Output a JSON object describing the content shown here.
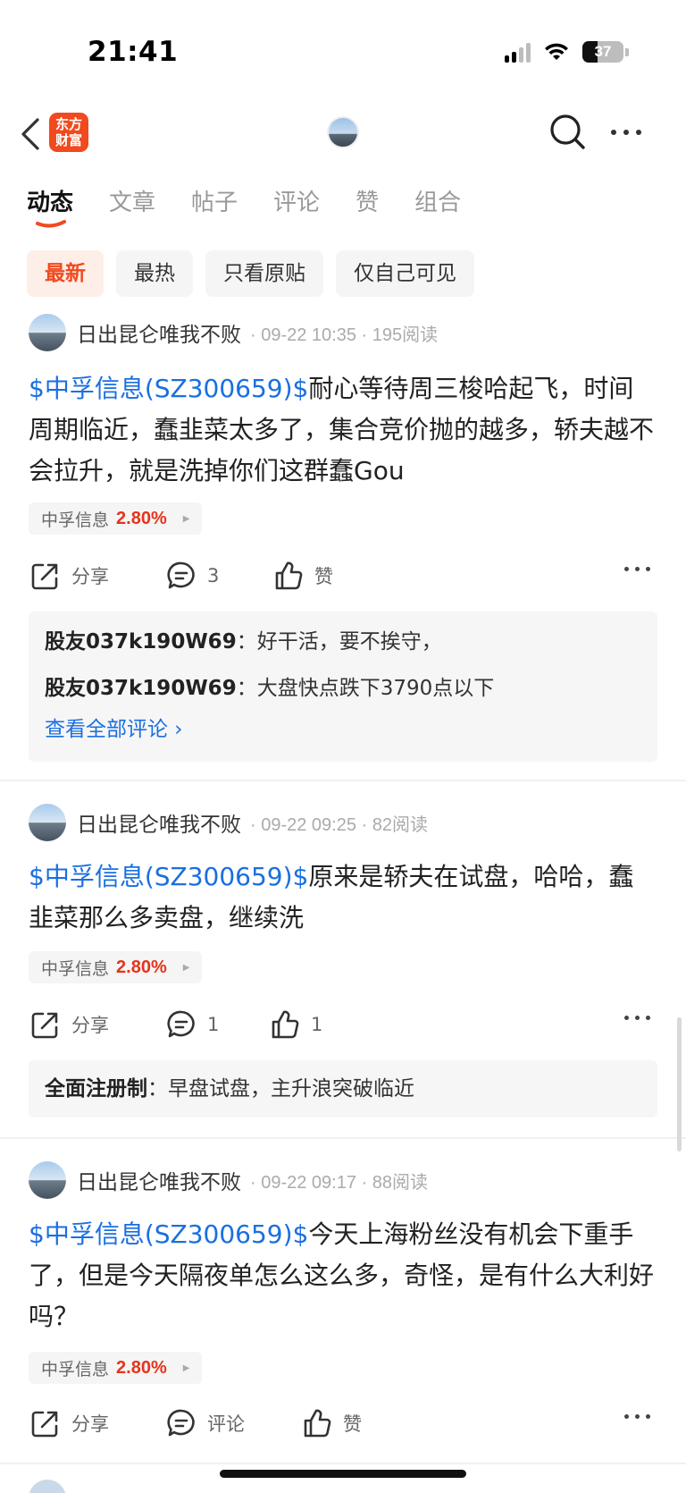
{
  "status": {
    "time": "21:41",
    "battery": "37",
    "battery_level": 0.37
  },
  "nav": {
    "logo_text_top": "东方",
    "logo_text_bottom": "财富"
  },
  "tabs": [
    {
      "label": "动态",
      "active": true
    },
    {
      "label": "文章",
      "active": false
    },
    {
      "label": "帖子",
      "active": false
    },
    {
      "label": "评论",
      "active": false
    },
    {
      "label": "赞",
      "active": false
    },
    {
      "label": "组合",
      "active": false
    }
  ],
  "filters": [
    {
      "label": "最新",
      "active": true
    },
    {
      "label": "最热",
      "active": false
    },
    {
      "label": "只看原贴",
      "active": false
    },
    {
      "label": "仅自己可见",
      "active": false
    }
  ],
  "posts": [
    {
      "author": "日出昆仑唯我不败",
      "meta": "· 09-22 10:35 · 195阅读",
      "stock_link": "$中孚信息(SZ300659)$",
      "text": "耐心等待周三梭哈起飞，时间周期临近，蠢韭菜太多了，集合竞价抛的越多，轿夫越不会拉升，就是洗掉你们这群蠢Gou",
      "tag_name": "中孚信息",
      "tag_pct": "2.80%",
      "share_label": "分享",
      "comment_label": "3",
      "like_label": "赞",
      "comments": [
        {
          "user": "股友037k190W69",
          "sep": "：",
          "text": "好干活，要不挨守，"
        },
        {
          "user": "股友037k190W69",
          "sep": "：",
          "text": "大盘快点跌下3790点以下"
        }
      ],
      "view_all": "查看全部评论 ›"
    },
    {
      "author": "日出昆仑唯我不败",
      "meta": "· 09-22 09:25 · 82阅读",
      "stock_link": "$中孚信息(SZ300659)$",
      "text": "原来是轿夫在试盘，哈哈，蠢韭菜那么多卖盘，继续洗",
      "tag_name": "中孚信息",
      "tag_pct": "2.80%",
      "share_label": "分享",
      "comment_label": "1",
      "like_label": "1",
      "comments": [
        {
          "user": "全面注册制",
          "sep": "：",
          "text": "早盘试盘，主升浪突破临近"
        }
      ]
    },
    {
      "author": "日出昆仑唯我不败",
      "meta": "· 09-22 09:17 · 88阅读",
      "stock_link": "$中孚信息(SZ300659)$",
      "text": "今天上海粉丝没有机会下重手了，但是今天隔夜单怎么这么多，奇怪，是有什么大利好吗？",
      "tag_name": "中孚信息",
      "tag_pct": "2.80%",
      "share_label": "分享",
      "comment_label": "评论",
      "like_label": "赞"
    }
  ]
}
